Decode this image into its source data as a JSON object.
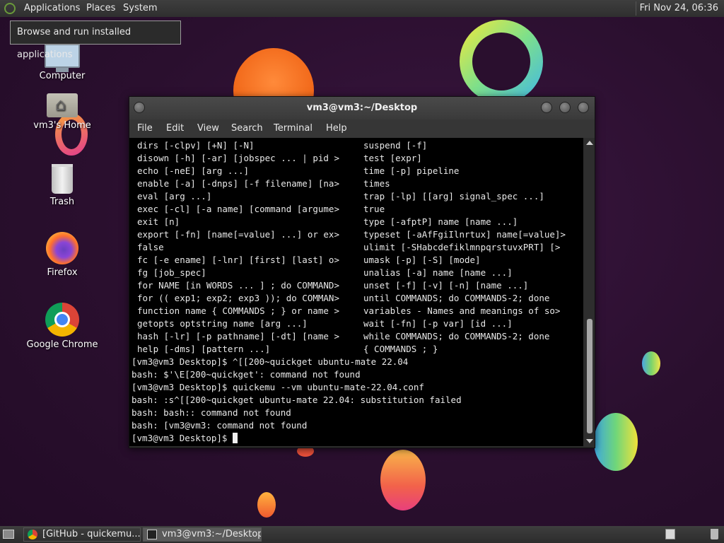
{
  "top_panel": {
    "menus": [
      "Applications",
      "Places",
      "System"
    ],
    "clock": "Fri Nov 24, 06:36"
  },
  "tooltip": "Browse and run installed applications",
  "desktop_icons": {
    "computer": "Computer",
    "home": "vm3's Home",
    "trash": "Trash",
    "firefox": "Firefox",
    "chrome": "Google Chrome"
  },
  "terminal": {
    "title": "vm3@vm3:~/Desktop",
    "menu": [
      "File",
      "Edit",
      "View",
      "Search",
      "Terminal",
      "Help"
    ],
    "help_left": [
      "dirs [-clpv] [+N] [-N]",
      "disown [-h] [-ar] [jobspec ... | pid >",
      "echo [-neE] [arg ...]",
      "enable [-a] [-dnps] [-f filename] [na>",
      "eval [arg ...]",
      "exec [-cl] [-a name] [command [argume>",
      "exit [n]",
      "export [-fn] [name[=value] ...] or ex>",
      "false",
      "fc [-e ename] [-lnr] [first] [last] o>",
      "fg [job_spec]",
      "for NAME [in WORDS ... ] ; do COMMAND>",
      "for (( exp1; exp2; exp3 )); do COMMAN>",
      "function name { COMMANDS ; } or name >",
      "getopts optstring name [arg ...]",
      "hash [-lr] [-p pathname] [-dt] [name >",
      "help [-dms] [pattern ...]"
    ],
    "help_right": [
      "suspend [-f]",
      "test [expr]",
      "time [-p] pipeline",
      "times",
      "trap [-lp] [[arg] signal_spec ...]",
      "true",
      "type [-afptP] name [name ...]",
      "typeset [-aAfFgiIlnrtux] name[=value]>",
      "ulimit [-SHabcdefiklmnpqrstuvxPRT] [>",
      "umask [-p] [-S] [mode]",
      "unalias [-a] name [name ...]",
      "unset [-f] [-v] [-n] [name ...]",
      "until COMMANDS; do COMMANDS-2; done",
      "variables - Names and meanings of so>",
      "wait [-fn] [-p var] [id ...]",
      "while COMMANDS; do COMMANDS-2; done",
      "{ COMMANDS ; }"
    ],
    "output": [
      "[vm3@vm3 Desktop]$ ^[[200~quickget ubuntu-mate 22.04",
      "bash: $'\\E[200~quickget': command not found",
      "[vm3@vm3 Desktop]$ quickemu --vm ubuntu-mate-22.04.conf",
      "bash: :s^[[200~quickget ubuntu-mate 22.04: substitution failed",
      "bash: bash:: command not found",
      "bash: [vm3@vm3: command not found"
    ],
    "prompt": "[vm3@vm3 Desktop]$ "
  },
  "taskbar": {
    "tasks": [
      "[GitHub - quickemu...",
      "vm3@vm3:~/Desktop"
    ]
  }
}
